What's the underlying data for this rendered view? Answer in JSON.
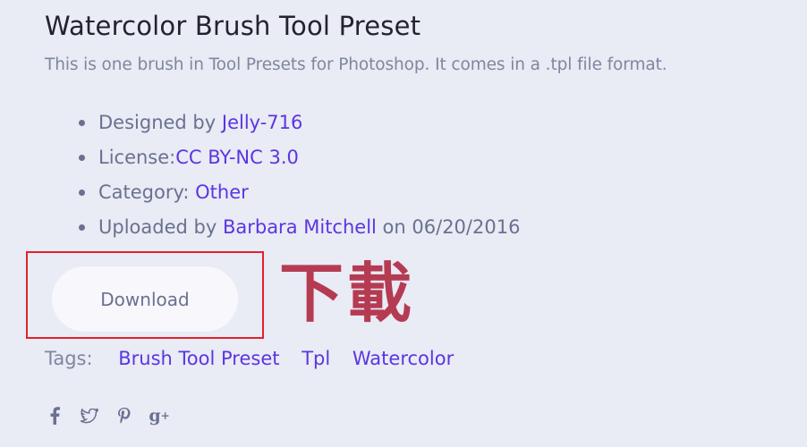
{
  "page": {
    "title": "Watercolor Brush Tool Preset",
    "subtitle": "This is one brush in Tool Presets for Photoshop. It comes in a .tpl file format."
  },
  "meta": {
    "designed_by_label": "Designed by ",
    "designer": "Jelly-716",
    "license_label": "License:",
    "license": "CC BY-NC 3.0",
    "category_label": "Category: ",
    "category": "Other",
    "uploaded_by_label": "Uploaded by ",
    "uploader": "Barbara Mitchell",
    "uploaded_on_label": " on ",
    "upload_date": "06/20/2016"
  },
  "download": {
    "button_label": "Download",
    "annotation": "下載",
    "highlight_color": "#e3202b",
    "annotation_color": "#b53b52"
  },
  "tags": {
    "label": "Tags:",
    "items": [
      "Brush Tool Preset",
      "Tpl",
      "Watercolor"
    ]
  },
  "social": {
    "icons": [
      "facebook-icon",
      "twitter-icon",
      "pinterest-icon",
      "google-plus-icon"
    ]
  },
  "colors": {
    "background": "#e9ebf5",
    "link": "#5b36e0",
    "text": "#6a7190",
    "title": "#24222e"
  }
}
